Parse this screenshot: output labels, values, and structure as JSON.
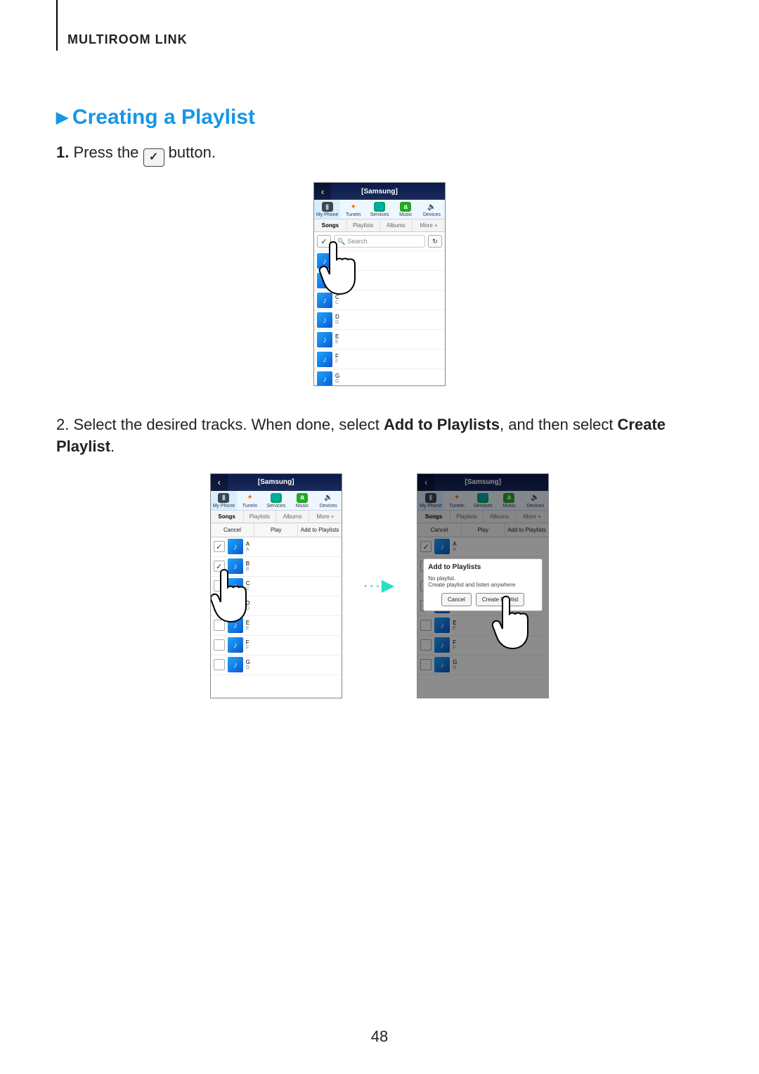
{
  "header": "MULTIROOM LINK",
  "section_title": "Creating a Playlist",
  "steps": {
    "s1": {
      "num": "1.",
      "before": "Press the ",
      "after": " button."
    },
    "s2": {
      "num": "2.",
      "before": "Select the desired tracks. When done, select ",
      "bold1": "Add to Playlists",
      "mid": ", and then select ",
      "bold2": "Create Playlist",
      "end": "."
    }
  },
  "phone": {
    "title": "[Samsung]",
    "nav": [
      "My Phone",
      "TuneIn",
      "Services",
      "Music",
      "Devices"
    ],
    "tabs": [
      "Songs",
      "Playlists",
      "Albums",
      "More +"
    ],
    "search_placeholder": "Search",
    "actions": {
      "cancel": "Cancel",
      "play": "Play",
      "add": "Add to Playlists"
    },
    "tracks": [
      "A",
      "B",
      "C",
      "D",
      "E",
      "F",
      "G"
    ],
    "popup": {
      "title": "Add to Playlists",
      "sub1": "No playlist.",
      "sub2": "Create playlist and listen anywhere",
      "cancel": "Cancel",
      "create": "Create Playlist"
    }
  },
  "page_number": "48"
}
